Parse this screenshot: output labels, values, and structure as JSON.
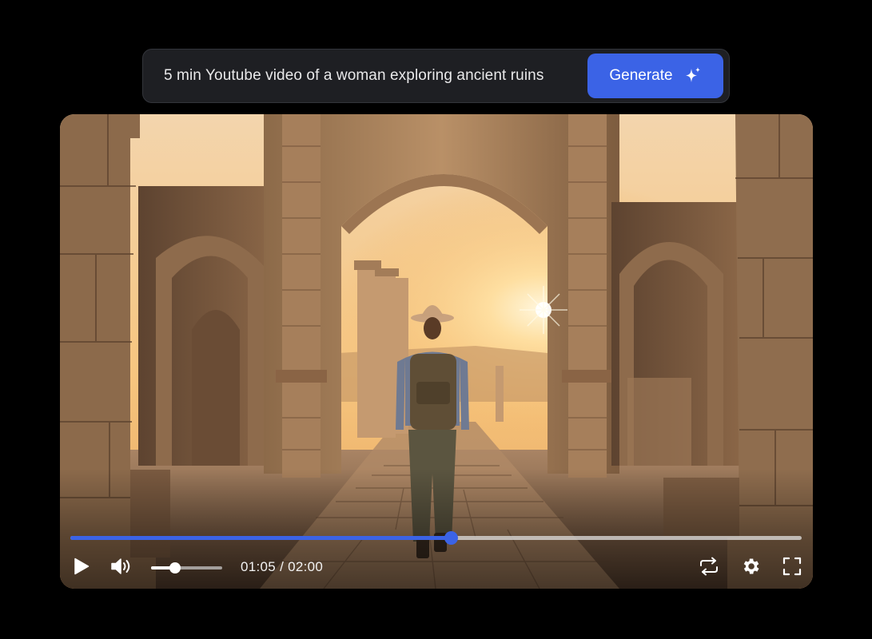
{
  "prompt": {
    "text": "5 min Youtube video of a woman exploring ancient ruins",
    "generate_label": "Generate",
    "generate_icon": "sparkle-icon"
  },
  "player": {
    "progress": 0.52,
    "volume": 0.34,
    "time_display": "01:05 / 02:00",
    "icons": [
      "play-icon",
      "volume-icon",
      "loop-icon",
      "settings-icon",
      "fullscreen-icon"
    ]
  },
  "colors": {
    "accent": "#3b63e6",
    "bar_background": "#1e1f23",
    "page_background": "#000000"
  }
}
